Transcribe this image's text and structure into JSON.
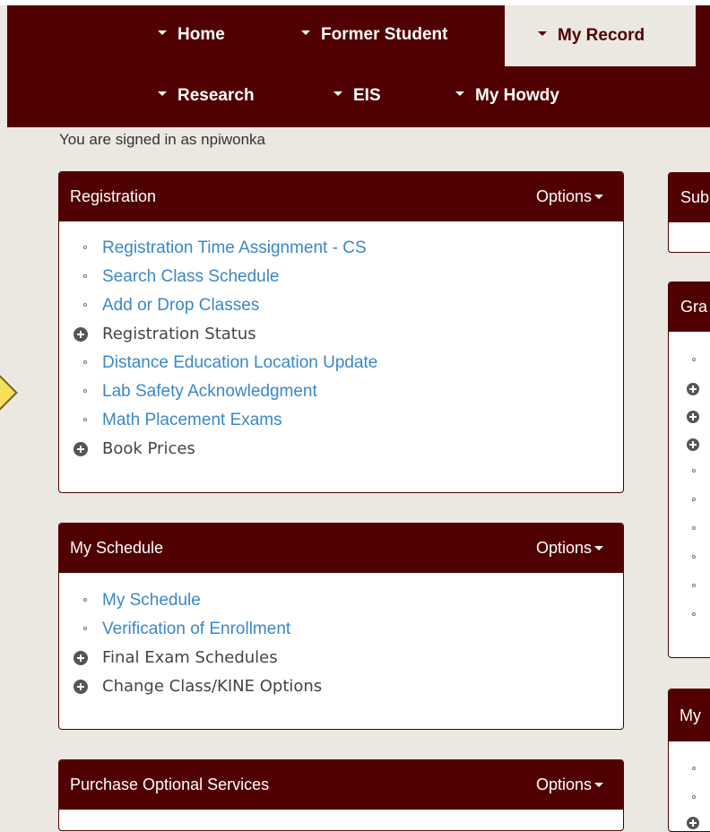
{
  "nav": {
    "items": [
      {
        "label": "Home"
      },
      {
        "label": "Former Student"
      },
      {
        "label": "My Record"
      },
      {
        "label": "Research"
      },
      {
        "label": "EIS"
      },
      {
        "label": "My Howdy"
      }
    ]
  },
  "signed_in": "You are signed in as npiwonka",
  "options_label": "Options",
  "panels": {
    "registration": {
      "title": "Registration",
      "items": [
        "Registration Time Assignment - CS",
        "Search Class Schedule",
        "Add or Drop Classes",
        "Registration Status",
        "Distance Education Location Update",
        "Lab Safety Acknowledgment",
        "Math Placement Exams",
        "Book Prices"
      ]
    },
    "schedule": {
      "title": "My Schedule",
      "items": [
        "My Schedule",
        "Verification of Enrollment",
        "Final Exam Schedules",
        "Change Class/KINE Options"
      ]
    },
    "purchase": {
      "title": "Purchase Optional Services"
    }
  },
  "right_panels": {
    "sub": "Sub",
    "gra": "Gra",
    "my": "My"
  },
  "colors": {
    "maroon": "#500000",
    "link": "#3a87c8",
    "background": "#ebe8e1"
  }
}
